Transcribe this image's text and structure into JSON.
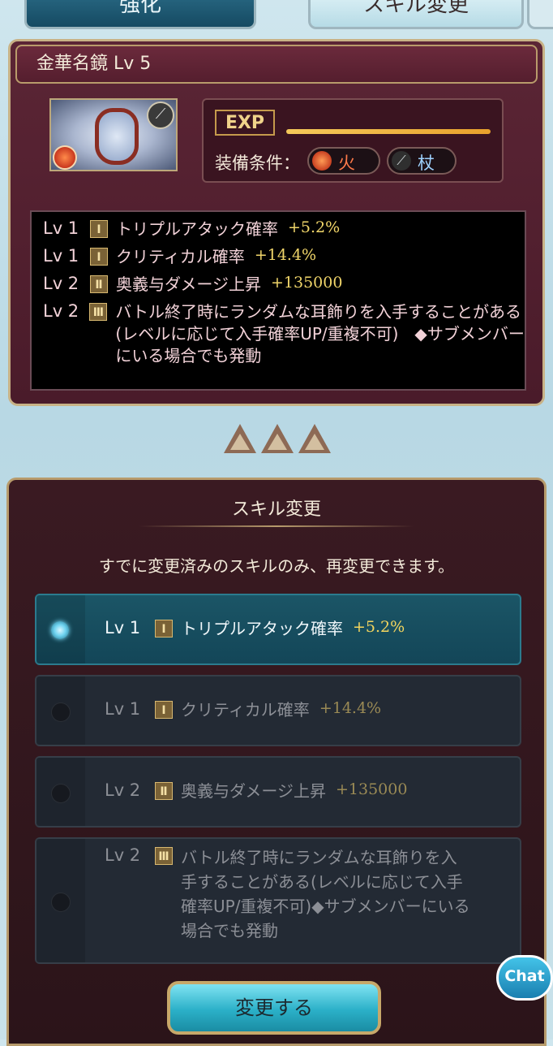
{
  "tabs": {
    "left_label": "強化",
    "right_label": "スキル変更"
  },
  "item": {
    "title": "金華名鏡 Lv 5",
    "exp_label": "EXP",
    "exp_fill_fraction": 1.0,
    "equip_label": "装備条件：",
    "equip_element": "火",
    "equip_weapon": "杖",
    "icons": [
      "mirror-image",
      "fire-icon",
      "staff-icon"
    ]
  },
  "skills": [
    {
      "lv": "Lv 1",
      "rank": "Ⅰ",
      "name": "トリプルアタック確率",
      "value": "+5.2%"
    },
    {
      "lv": "Lv 1",
      "rank": "Ⅰ",
      "name": "クリティカル確率",
      "value": "+14.4%"
    },
    {
      "lv": "Lv 2",
      "rank": "Ⅱ",
      "name": "奥義与ダメージ上昇",
      "value": "+135000"
    },
    {
      "lv": "Lv 2",
      "rank": "Ⅲ",
      "name": "バトル終了時にランダムな耳飾りを入手することがある(レベルに応じて入手確率UP/重複不可)　◆サブメンバーにいる場合でも発動"
    }
  ],
  "change": {
    "title": "スキル変更",
    "note": "すでに変更済みのスキルのみ、再変更できます。",
    "options": [
      {
        "lv": "Lv 1",
        "rank": "Ⅰ",
        "name": "トリプルアタック確率",
        "value": "+5.2%",
        "selected": true
      },
      {
        "lv": "Lv 1",
        "rank": "Ⅰ",
        "name": "クリティカル確率",
        "value": "+14.4%",
        "selected": false
      },
      {
        "lv": "Lv 2",
        "rank": "Ⅱ",
        "name": "奥義与ダメージ上昇",
        "value": "+135000",
        "selected": false
      },
      {
        "lv": "Lv 2",
        "rank": "Ⅲ",
        "name": "バトル終了時にランダムな耳飾りを入手することがある(レベルに応じて入手確率UP/重複不可)◆サブメンバーにいる場合でも発動",
        "selected": false
      }
    ],
    "submit_label": "変更する"
  },
  "chat_label": "Chat",
  "colors": {
    "panel": "#4a1b2a",
    "gold": "#c8b286",
    "selected": "#134658",
    "value": "#f1d66a"
  }
}
